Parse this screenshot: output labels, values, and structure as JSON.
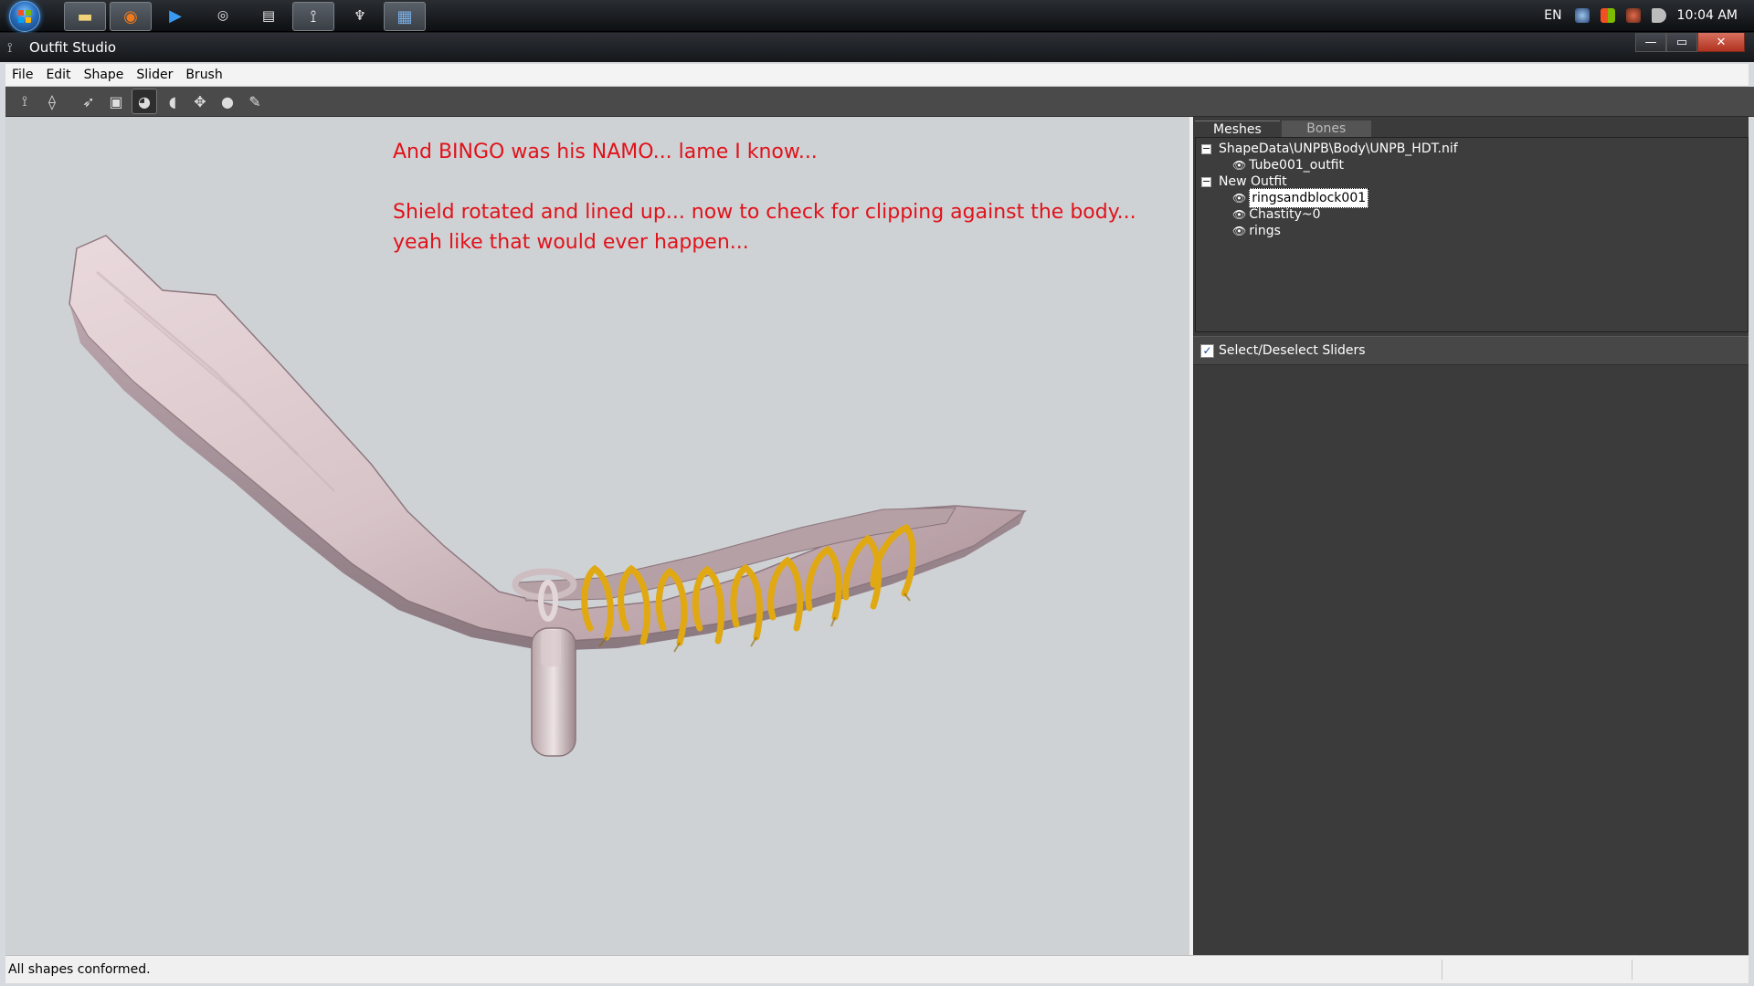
{
  "taskbar": {
    "apps": [
      {
        "icon": "folder-icon",
        "active": true
      },
      {
        "icon": "firefox-icon",
        "active": true
      },
      {
        "icon": "media-play-icon",
        "active": false
      },
      {
        "icon": "circle-app-icon",
        "active": false
      },
      {
        "icon": "disk-app-icon",
        "active": false
      },
      {
        "icon": "outfit-studio-icon",
        "active": true
      },
      {
        "icon": "feather-icon",
        "active": false
      },
      {
        "icon": "tool-app-icon",
        "active": true
      }
    ],
    "tray": {
      "language": "EN",
      "clock": "10:04 AM",
      "icons": [
        "steam-icon",
        "windows-flag-icon",
        "network-icon",
        "volume-icon"
      ]
    }
  },
  "window": {
    "title": "Outfit Studio",
    "controls": {
      "minimize": "—",
      "maximize": "▭",
      "close": "✕"
    }
  },
  "menu": {
    "file": "File",
    "edit": "Edit",
    "shape": "Shape",
    "slider": "Slider",
    "brush": "Brush"
  },
  "toolbar": {
    "tools": [
      {
        "name": "load-project-tool",
        "glyph": "⟟"
      },
      {
        "name": "save-project-tool",
        "glyph": "⟠"
      },
      {
        "name": "select-tool",
        "glyph": "➶"
      },
      {
        "name": "mask-tool",
        "glyph": "▣"
      },
      {
        "name": "inflate-brush-tool",
        "glyph": "◕"
      },
      {
        "name": "deflate-brush-tool",
        "glyph": "◖"
      },
      {
        "name": "move-brush-tool",
        "glyph": "✥"
      },
      {
        "name": "smooth-brush-tool",
        "glyph": "●"
      },
      {
        "name": "weight-brush-tool",
        "glyph": "✎"
      }
    ]
  },
  "viewport": {
    "annotation": {
      "line1": "And BINGO was his NAMO... lame I know...",
      "line2": "Shield rotated and lined up... now to check for clipping against the body...",
      "line3": "yeah like that would ever happen..."
    },
    "colors": {
      "background": "#cfd2d5",
      "annotation": "#e0121a",
      "mesh": "#d9c8cc",
      "rings": "#e0a812"
    }
  },
  "panel": {
    "tabs": {
      "meshes": "Meshes",
      "bones": "Bones"
    },
    "tree": {
      "group1": "ShapeData\\UNPB\\Body\\UNPB_HDT.nif",
      "group1_items": [
        "Tube001_outfit"
      ],
      "group2": "New Outfit",
      "group2_items": [
        "ringsandblock001",
        "Chastity~0",
        "rings"
      ],
      "selected": "ringsandblock001"
    },
    "sliders": {
      "select_all_label": "Select/Deselect Sliders",
      "checked": true
    }
  },
  "status": {
    "text": "All shapes conformed."
  }
}
